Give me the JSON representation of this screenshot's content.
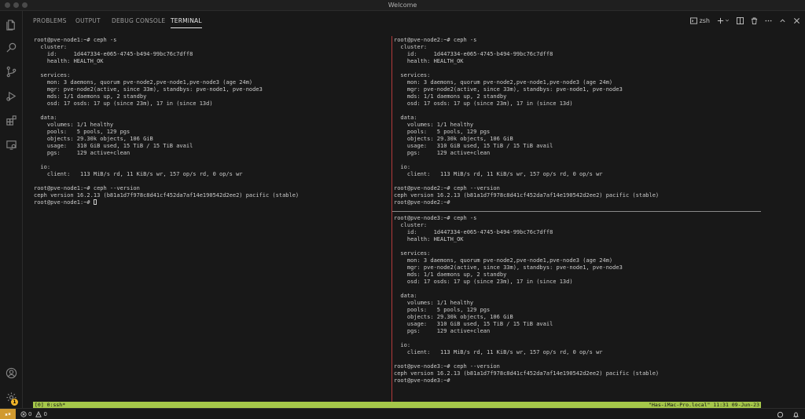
{
  "window": {
    "title": "Welcome"
  },
  "panel": {
    "tabs": [
      "PROBLEMS",
      "OUTPUT",
      "DEBUG CONSOLE",
      "TERMINAL"
    ],
    "active_tab": "TERMINAL",
    "shell_label": "zsh"
  },
  "terminal": {
    "left_pane": [
      "root@pve-node1:~# ceph -s",
      "  cluster:",
      "    id:     1d447334-e065-4745-b494-99bc76c7dff8",
      "    health: HEALTH_OK",
      "",
      "  services:",
      "    mon: 3 daemons, quorum pve-node2,pve-node1,pve-node3 (age 24m)",
      "    mgr: pve-node2(active, since 33m), standbys: pve-node1, pve-node3",
      "    mds: 1/1 daemons up, 2 standby",
      "    osd: 17 osds: 17 up (since 23m), 17 in (since 13d)",
      "",
      "  data:",
      "    volumes: 1/1 healthy",
      "    pools:   5 pools, 129 pgs",
      "    objects: 29.30k objects, 106 GiB",
      "    usage:   310 GiB used, 15 TiB / 15 TiB avail",
      "    pgs:     129 active+clean",
      "",
      "  io:",
      "    client:   113 MiB/s rd, 11 KiB/s wr, 157 op/s rd, 0 op/s wr",
      "",
      "root@pve-node1:~# ceph --version",
      "ceph version 16.2.13 (b81a1d7f978c8d41cf452da7af14e190542d2ee2) pacific (stable)"
    ],
    "left_prompt": "root@pve-node1:~# ",
    "top_right_pane": [
      "root@pve-node2:~# ceph -s",
      "  cluster:",
      "    id:     1d447334-e065-4745-b494-99bc76c7dff8",
      "    health: HEALTH_OK",
      "",
      "  services:",
      "    mon: 3 daemons, quorum pve-node2,pve-node1,pve-node3 (age 24m)",
      "    mgr: pve-node2(active, since 33m), standbys: pve-node1, pve-node3",
      "    mds: 1/1 daemons up, 2 standby",
      "    osd: 17 osds: 17 up (since 23m), 17 in (since 13d)",
      "",
      "  data:",
      "    volumes: 1/1 healthy",
      "    pools:   5 pools, 129 pgs",
      "    objects: 29.30k objects, 106 GiB",
      "    usage:   310 GiB used, 15 TiB / 15 TiB avail",
      "    pgs:     129 active+clean",
      "",
      "  io:",
      "    client:   113 MiB/s rd, 11 KiB/s wr, 157 op/s rd, 0 op/s wr",
      "",
      "root@pve-node2:~# ceph --version",
      "ceph version 16.2.13 (b81a1d7f978c8d41cf452da7af14e190542d2ee2) pacific (stable)",
      "root@pve-node2:~#"
    ],
    "bottom_right_pane": [
      "root@pve-node3:~# ceph -s",
      "  cluster:",
      "    id:     1d447334-e065-4745-b494-99bc76c7dff8",
      "    health: HEALTH_OK",
      "",
      "  services:",
      "    mon: 3 daemons, quorum pve-node2,pve-node1,pve-node3 (age 24m)",
      "    mgr: pve-node2(active, since 33m), standbys: pve-node1, pve-node3",
      "    mds: 1/1 daemons up, 2 standby",
      "    osd: 17 osds: 17 up (since 23m), 17 in (since 13d)",
      "",
      "  data:",
      "    volumes: 1/1 healthy",
      "    pools:   5 pools, 129 pgs",
      "    objects: 29.30k objects, 106 GiB",
      "    usage:   310 GiB used, 15 TiB / 15 TiB avail",
      "    pgs:     129 active+clean",
      "",
      "  io:",
      "    client:   113 MiB/s rd, 11 KiB/s wr, 157 op/s rd, 0 op/s wr",
      "",
      "root@pve-node3:~# ceph --version",
      "ceph version 16.2.13 (b81a1d7f978c8d41cf452da7af14e190542d2ee2) pacific (stable)",
      "root@pve-node3:~#"
    ]
  },
  "tmux": {
    "left": "[0] 0:ssh*",
    "right": "\"Has-iMac-Pro.local\" 11:31 09-Jun-23"
  },
  "statusbar": {
    "errors": "0",
    "warnings": "0",
    "remote_icon": "remote-icon",
    "accent_color": "#d19a30"
  },
  "activity": {
    "icons": [
      "files-icon",
      "search-icon",
      "source-control-icon",
      "run-debug-icon",
      "extensions-icon",
      "remote-explorer-icon",
      "account-icon",
      "settings-gear-icon"
    ],
    "settings_badge": "1"
  },
  "colors": {
    "tmux_bar": "#a5c74a",
    "pane_split_active": "#b33a3a"
  }
}
